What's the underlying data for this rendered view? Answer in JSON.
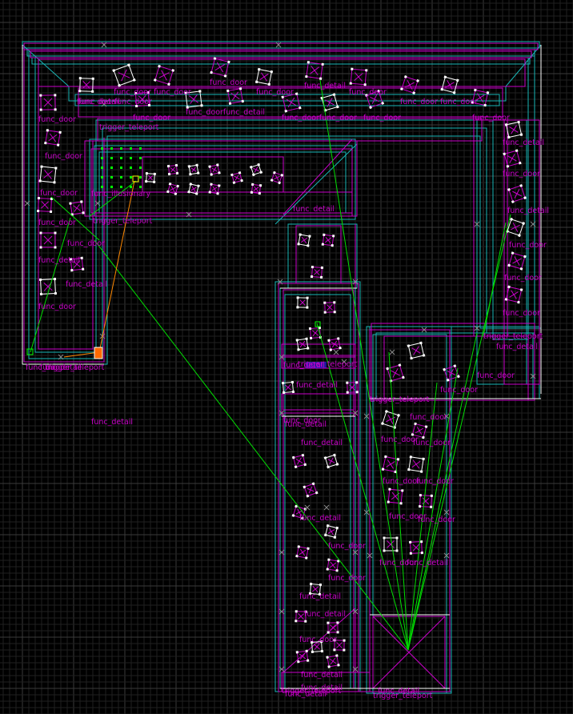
{
  "view": {
    "background": "#000000",
    "grid_major": "#3a3a3a",
    "grid_minor": "#202020",
    "colors": {
      "brush_magenta": "#c800c8",
      "brush_cyan": "#18b6b6",
      "selected_white": "#ffffff",
      "target_line": "#00e000",
      "path_orange": "#ff8800",
      "entity_label": "#c800c8"
    }
  },
  "entity_labels": {
    "detail_1": "func_detail",
    "door_1": "func_door",
    "door_2": "func_door",
    "door_3": "func_door",
    "door_4": "func_door",
    "detail_2": "func_detail",
    "door_5": "func_door",
    "doorfunc_detail_1": "func_doorfunc_detail",
    "door_6": "func_door",
    "doorfunc_door_1": "func_doorfunc_door",
    "door_7": "func_door",
    "door_8": "func_door",
    "door_9": "func_door",
    "door_10": "func_door",
    "door_11": "func_door",
    "doorfunc_door_2": "func_doorfunc_door",
    "door_12": "func_door",
    "teleport_1": "trigger_teleport",
    "door_13": "func_door",
    "detail_3": "func_detail",
    "door_14": "func_door",
    "door_15": "func_door",
    "illusionary": "func_illusionary",
    "teleport_2": "trigger_teleport",
    "detail_4": "func_detail",
    "door_16": "func_door",
    "door_17": "func_door",
    "detail_5": "func_detail",
    "detail_6": "func_detail",
    "door_18": "func_door",
    "detail_7": "func_detail",
    "door_19": "func_door",
    "door_20": "func_door",
    "teleport_3": "trigger_teleport",
    "detail_8": "func_detail",
    "detail_9": "func_detail",
    "door_21": "func_door",
    "detail_10": "func_detail",
    "door_22": "func_door",
    "teleport_4": "trigger_teleport",
    "door_23": "func_door",
    "door_24": "func_door",
    "detail_11": "func_detail",
    "detail_12": "func_detail",
    "door_25": "func_door",
    "door_26": "func_door",
    "door_27": "func_door",
    "detail_13": "func_detail",
    "door_28": "func_door",
    "door_29": "func_door",
    "door_30": "func_door",
    "teleport_5": "trigger_teleport",
    "door_31": "func_door",
    "door_32": "func_door",
    "door_33": "func_door",
    "detail_14": "func_detail",
    "detail_15": "func_detail",
    "detail_16": "func_detail",
    "detail_17": "func_detail",
    "door_34": "func_door",
    "detail_18": "func_detail",
    "detail_19": "func_detail",
    "detail_20": "func_detail",
    "teleport_6": "trigger_teleport",
    "door_35": "func_door",
    "detail_21": "func_detail",
    "teleport_7": "trigger_teleport",
    "detail_22": "func_detail",
    "teleport_8": "trigger_teleport"
  }
}
